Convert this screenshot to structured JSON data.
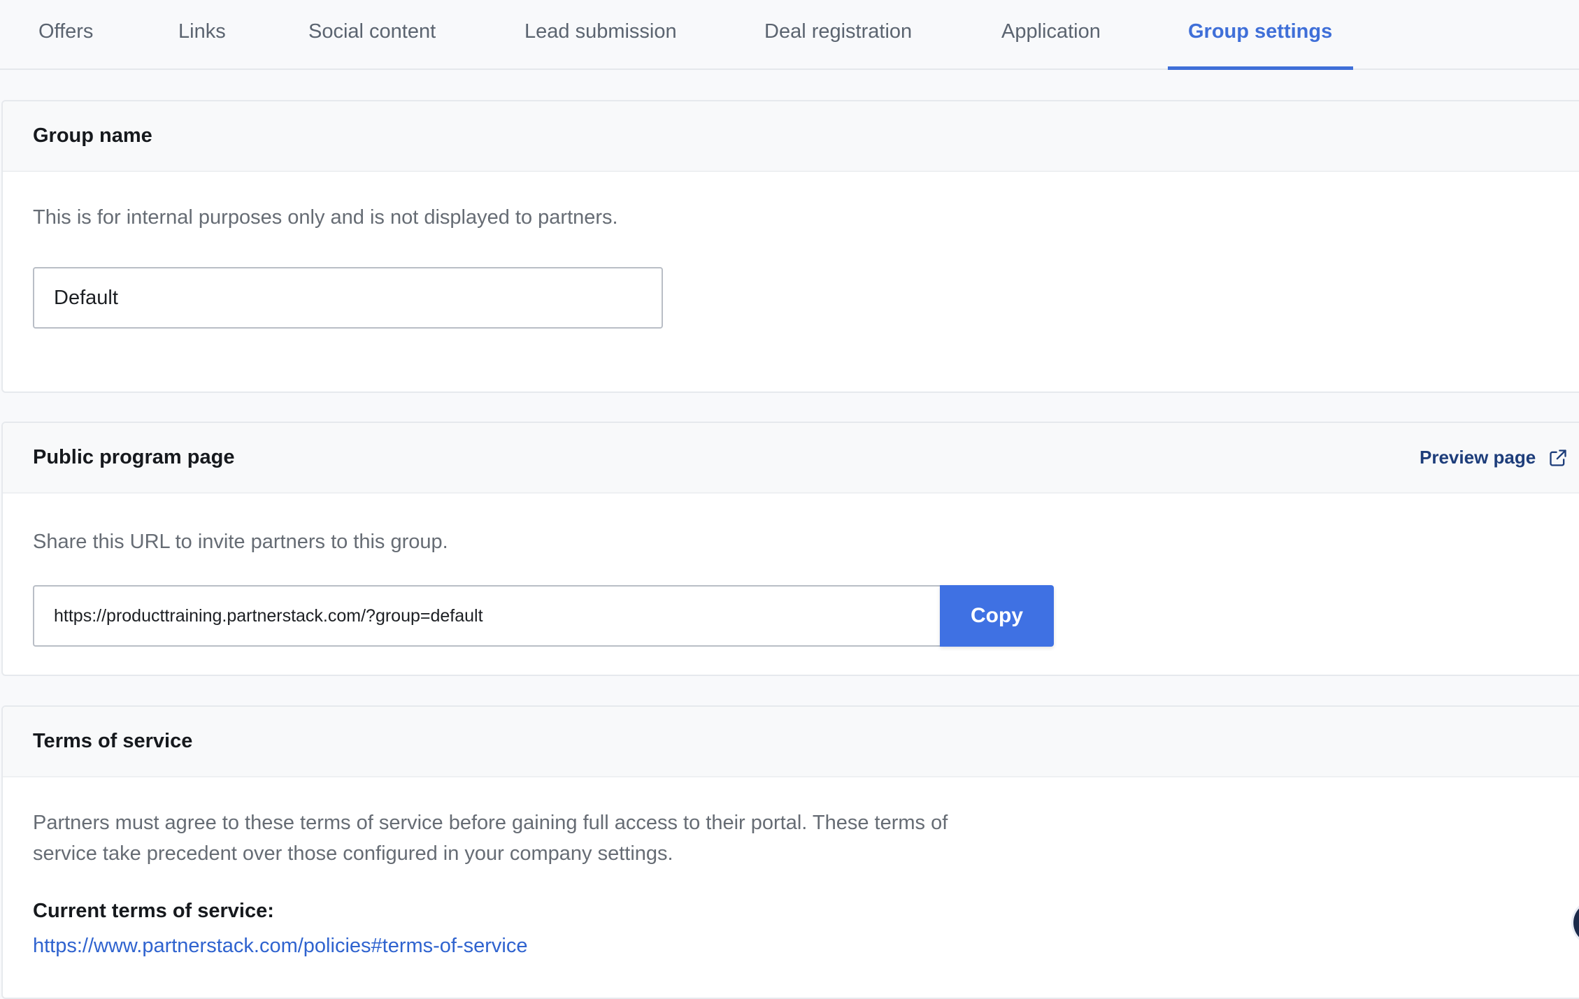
{
  "tabs": [
    {
      "label": "Offers",
      "active": false
    },
    {
      "label": "Links",
      "active": false
    },
    {
      "label": "Social content",
      "active": false
    },
    {
      "label": "Lead submission",
      "active": false
    },
    {
      "label": "Deal registration",
      "active": false
    },
    {
      "label": "Application",
      "active": false
    },
    {
      "label": "Group settings",
      "active": true
    }
  ],
  "group_name": {
    "title": "Group name",
    "description": "This is for internal purposes only and is not displayed to partners.",
    "value": "Default"
  },
  "public_program": {
    "title": "Public program page",
    "preview_label": "Preview page",
    "preview_icon": "external-link-icon",
    "description": "Share this URL to invite partners to this group.",
    "url": "https://producttraining.partnerstack.com/?group=default",
    "copy_label": "Copy"
  },
  "terms": {
    "title": "Terms of service",
    "description_line1": "Partners must agree to these terms of service before gaining full access to their portal. These terms of",
    "description_line2": "service take precedent over those configured in your company settings.",
    "current_label": "Current terms of service:",
    "link": "https://www.partnerstack.com/policies#terms-of-service"
  },
  "colors": {
    "accent": "#3f6fd8",
    "button": "#3f71e3",
    "link": "#2f63cf"
  }
}
